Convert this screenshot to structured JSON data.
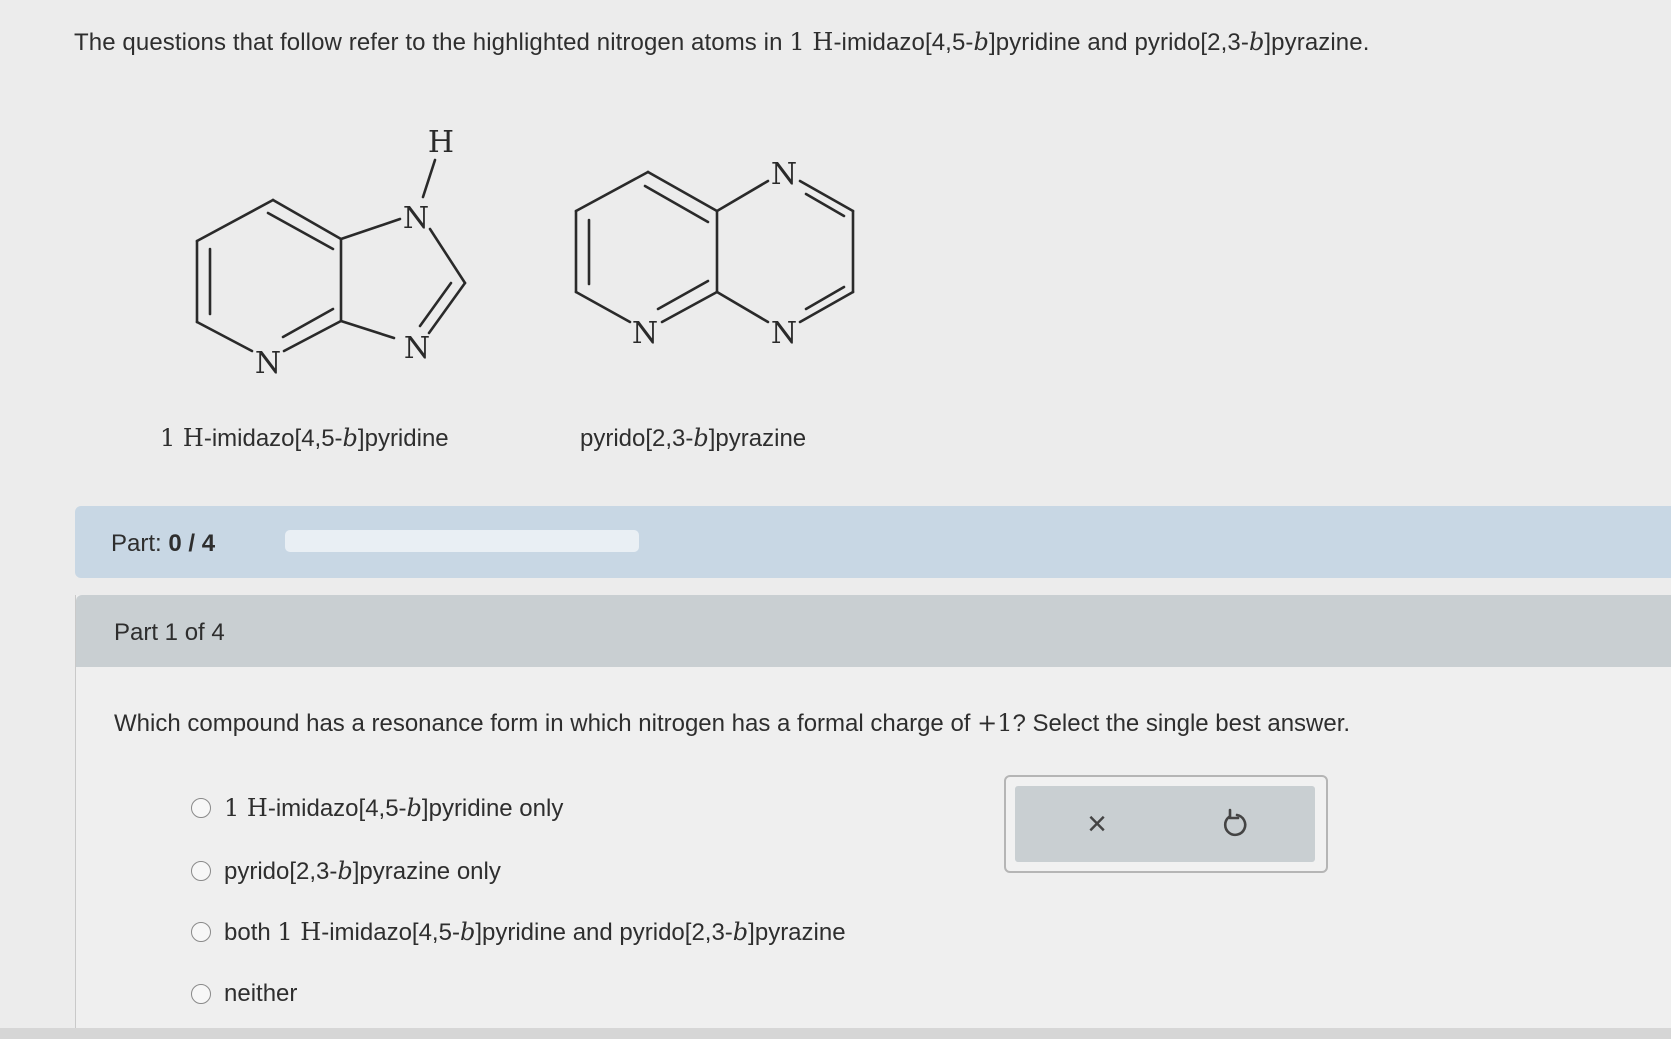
{
  "intro": {
    "prefix": "The questions that follow refer to the highlighted nitrogen atoms in ",
    "name1_prefix": "1 H",
    "name1_rest": "-imidazo[4,5-",
    "b": "b",
    "name1_end": "]pyridine and pyrido[2,3-",
    "name2_end": "]pyrazine."
  },
  "molecules": {
    "left": {
      "atom_labels": [
        "H",
        "N",
        "N",
        "N"
      ],
      "name_prefix": "1 H",
      "name_mid": "-imidazo[4,5-",
      "name_b": "b",
      "name_end": "]pyridine"
    },
    "right": {
      "atom_labels": [
        "N",
        "N",
        "N"
      ],
      "name_mid": "pyrido[2,3-",
      "name_b": "b",
      "name_end": "]pyrazine"
    }
  },
  "part_bar": {
    "label": "Part:",
    "score": "0 / 4",
    "progress": 0
  },
  "part_card": {
    "header": "Part 1 of 4",
    "question_prefix": "Which compound has a resonance form in which nitrogen has a formal charge of ",
    "question_charge": "+1",
    "question_suffix": "? Select the single best answer.",
    "options": [
      {
        "p1": "1 H",
        "p2": "-imidazo[4,5-",
        "b": "b",
        "p3": "]pyridine only"
      },
      {
        "p1": "pyrido[2,3-",
        "b": "b",
        "p3": "]pyrazine only"
      },
      {
        "p1": "both ",
        "p1s": "1 H",
        "p2": "-imidazo[4,5-",
        "b": "b",
        "p3": "]pyridine and pyrido[2,3-",
        "b2": "b",
        "p4": "]pyrazine"
      },
      {
        "p1": "neither"
      }
    ]
  },
  "actions": {
    "clear_icon": "×",
    "undo_icon": "↺"
  },
  "icons": {
    "clear": "close-icon",
    "undo": "undo-icon"
  }
}
